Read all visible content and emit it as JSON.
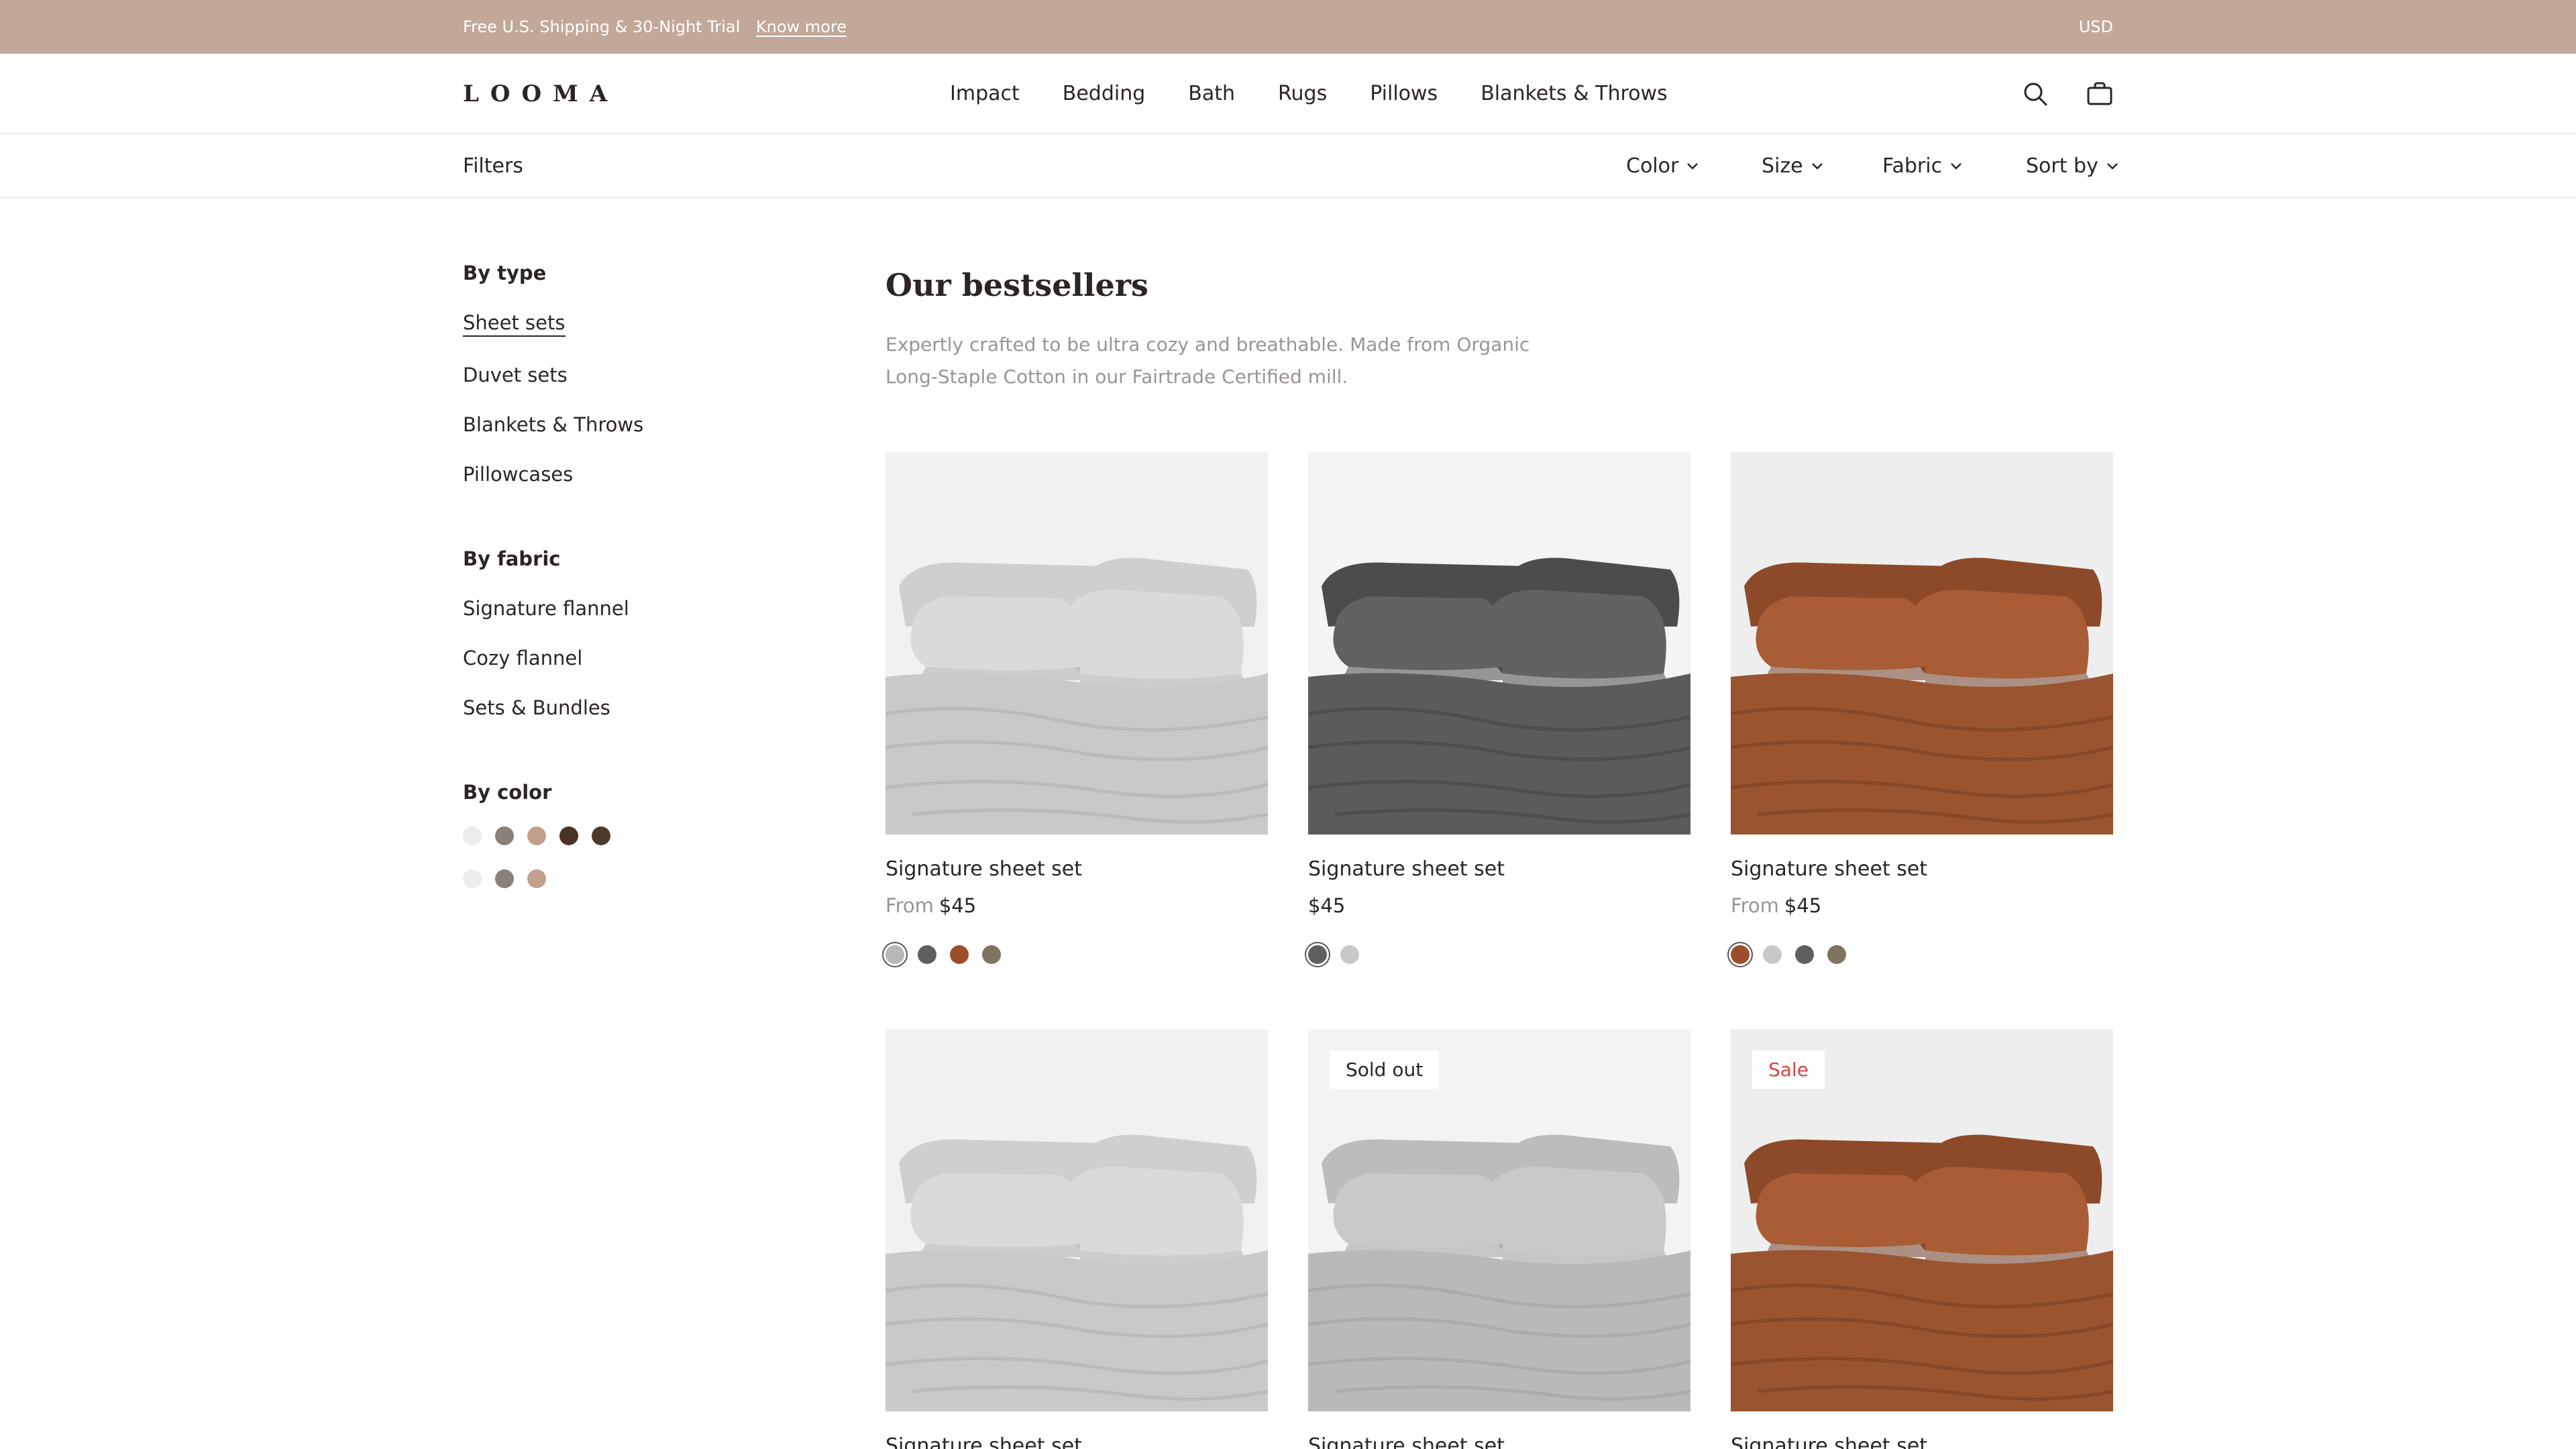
{
  "promo": {
    "message": "Free U.S. Shipping & 30-Night Trial",
    "link": "Know more",
    "currency": "USD"
  },
  "header": {
    "logo": "LOOMA",
    "nav": [
      "Impact",
      "Bedding",
      "Bath",
      "Rugs",
      "Pillows",
      "Blankets & Throws"
    ],
    "icons": [
      "search-icon",
      "shopping-bag-icon"
    ]
  },
  "filterbar": {
    "title": "Filters",
    "dropdowns": [
      "Color",
      "Size",
      "Fabric",
      "Sort by"
    ]
  },
  "sidebar": {
    "by_type": {
      "title": "By type",
      "items": [
        "Sheet sets",
        "Duvet sets",
        "Blankets & Throws",
        "Pillowcases"
      ],
      "active": "Sheet sets"
    },
    "by_fabric": {
      "title": "By fabric",
      "items": [
        "Signature flannel",
        "Cozy flannel",
        "Sets & Bundles"
      ]
    },
    "by_color": {
      "title": "By color",
      "row1": [
        "#ececec",
        "#8a817c",
        "#c2a08e",
        "#4a3325",
        "#4e3a2b"
      ],
      "row2": [
        "#ececec",
        "#8a817c",
        "#c2a08e"
      ]
    }
  },
  "main": {
    "heading": "Our bestsellers",
    "description_line1": "Expertly crafted to be ultra cozy and breathable. Made from Organic",
    "description_line2": "Long-Staple Cotton in our Fairtrade Certified mill."
  },
  "products": [
    {
      "name": "Signature sheet set",
      "from": "From",
      "price": "$45",
      "color_scheme": "light-grey",
      "swatches": [
        "#b8b8b8",
        "#5f5f5f",
        "#9c4f2a",
        "#7d7462"
      ],
      "selected": 0
    },
    {
      "name": "Signature sheet set",
      "from": "",
      "price": "$45",
      "color_scheme": "charcoal",
      "swatches": [
        "#5f5f5f",
        "#c8c8c8"
      ],
      "selected": 0
    },
    {
      "name": "Signature sheet set",
      "from": "From",
      "price": "$45",
      "color_scheme": "rust",
      "swatches": [
        "#9c4f2a",
        "#c8c8c8",
        "#5f5f5f",
        "#7d7462"
      ],
      "selected": 0
    },
    {
      "name": "Signature sheet set",
      "badge": "",
      "color_scheme": "light-grey"
    },
    {
      "name": "Signature sheet set",
      "badge": "Sold out",
      "badge_color": "#2b2523",
      "color_scheme": "grey"
    },
    {
      "name": "Signature sheet set",
      "badge": "Sale",
      "badge_color": "#d64545",
      "color_scheme": "rust"
    }
  ]
}
